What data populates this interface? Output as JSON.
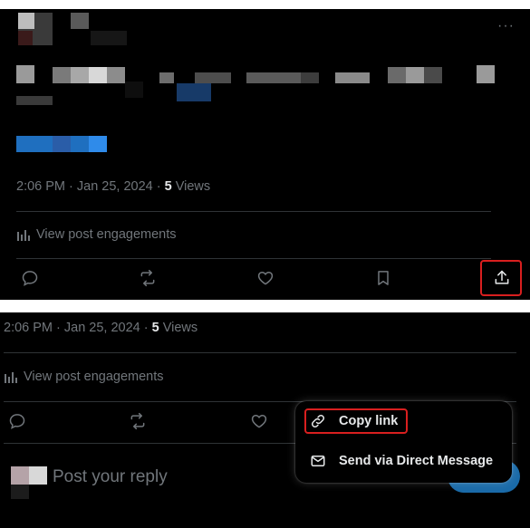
{
  "tweet": {
    "timestamp": "2:06 PM · Jan 25, 2024 · ",
    "views_count": "5",
    "views_label": " Views",
    "engagements_label": "View post engagements"
  },
  "share_menu": {
    "copy_link": "Copy link",
    "send_dm": "Send via Direct Message"
  },
  "reply": {
    "placeholder": "Post your reply"
  },
  "colors": {
    "background": "#000000",
    "text": "#e7e9ea",
    "muted": "#71767b",
    "highlight": "#d91f1f",
    "accent": "#1d9bf0"
  },
  "icons": [
    "more-icon",
    "reply-icon",
    "retweet-icon",
    "like-icon",
    "bookmark-icon",
    "share-icon",
    "analytics-icon",
    "link-icon",
    "envelope-icon"
  ]
}
